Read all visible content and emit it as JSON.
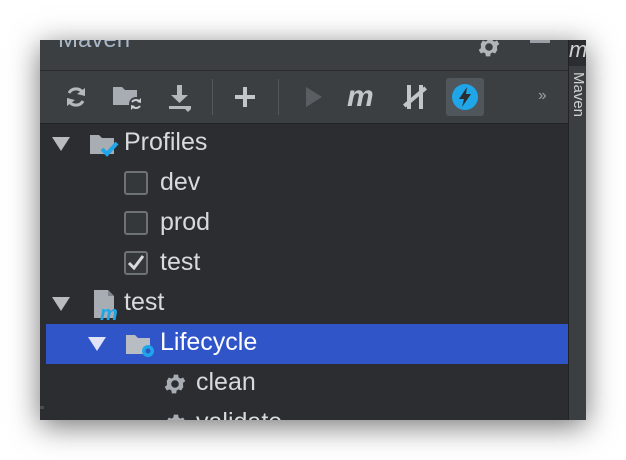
{
  "window": {
    "title": "Maven"
  },
  "side_tab": {
    "label": "Maven",
    "top_glyph": "m"
  },
  "toolbar": {
    "more": "››",
    "buttons": [
      {
        "icon": "refresh-icon"
      },
      {
        "icon": "folder-refresh-icon"
      },
      {
        "icon": "download-icon"
      },
      {
        "icon": "plus-icon"
      },
      {
        "icon": "run-icon"
      },
      {
        "icon": "maven-m-icon"
      },
      {
        "icon": "skip-tests-icon"
      },
      {
        "icon": "lightning-icon"
      }
    ]
  },
  "tree": {
    "profiles_label": "Profiles",
    "profiles": [
      {
        "label": "dev",
        "checked": false
      },
      {
        "label": "prod",
        "checked": false
      },
      {
        "label": "test",
        "checked": true
      }
    ],
    "project_label": "test",
    "lifecycle_label": "Lifecycle",
    "goals": [
      "clean",
      "validate"
    ]
  },
  "colors": {
    "selection": "#2f55c8",
    "accent": "#1fa6e8"
  }
}
